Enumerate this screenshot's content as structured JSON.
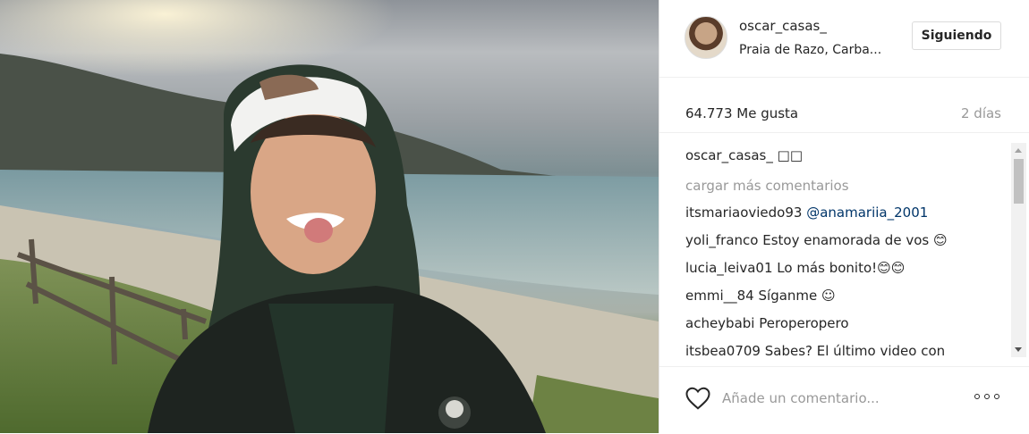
{
  "post": {
    "photo_icon": "post-photo"
  },
  "header": {
    "username": "oscar_casas_",
    "location": "Praia de Razo, Carba...",
    "follow_label": "Siguiendo"
  },
  "stats": {
    "likes": "64.773 Me gusta",
    "time": "2 días"
  },
  "comments": {
    "caption_user": "oscar_casas_",
    "caption_text": "□□",
    "load_more": "cargar más comentarios",
    "items": [
      {
        "user": "itsmariaoviedo93",
        "text": "@anamariia_2001",
        "mention": true
      },
      {
        "user": "yoli_franco",
        "text": "Estoy enamorada de vos 😊"
      },
      {
        "user": "lucia_leiva01",
        "text": "Lo más bonito!😊😊"
      },
      {
        "user": "emmi__84",
        "text": "Síganme ☺"
      },
      {
        "user": "acheybabi",
        "text": "Peroperopero"
      },
      {
        "user": "itsbea0709",
        "text": "Sabes? El último video con"
      }
    ]
  },
  "footer": {
    "placeholder": "Añade un comentario...",
    "like_icon": "heart-icon",
    "more_icon": "more-options-icon"
  }
}
